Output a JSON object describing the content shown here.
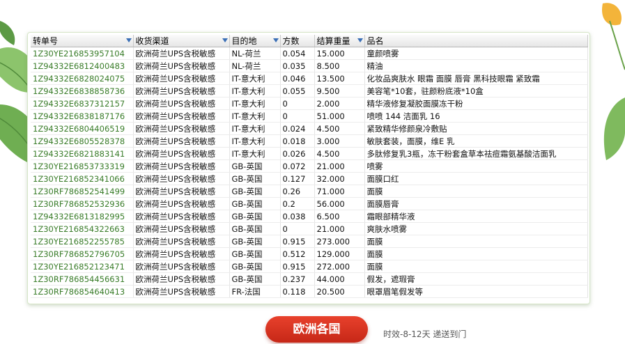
{
  "table": {
    "columns": [
      "转单号",
      "收货渠道",
      "目的地",
      "方数",
      "结算重量",
      "品名"
    ],
    "rows": [
      [
        "1Z30YE216853957104",
        "欧洲荷兰UPS含税敏感",
        "NL-荷兰",
        "0.054",
        "15.000",
        "童颜喷雾"
      ],
      [
        "1Z94332E6812400483",
        "欧洲荷兰UPS含税敏感",
        "NL-荷兰",
        "0.035",
        "8.500",
        "精油"
      ],
      [
        "1Z94332E6828024075",
        "欧洲荷兰UPS含税敏感",
        "IT-意大利",
        "0.046",
        "13.500",
        "化妆品爽肤水 眼霜 面膜 唇膏 黑科技眼霜 紧致霜"
      ],
      [
        "1Z94332E6838858736",
        "欧洲荷兰UPS含税敏感",
        "IT-意大利",
        "0.055",
        "9.500",
        "美容笔*10套，驻颜粉底液*10盒"
      ],
      [
        "1Z94332E6837312157",
        "欧洲荷兰UPS含税敏感",
        "IT-意大利",
        "0",
        "2.000",
        "精华液修复凝胶面膜冻干粉"
      ],
      [
        "1Z94332E6838187176",
        "欧洲荷兰UPS含税敏感",
        "IT-意大利",
        "0",
        "51.000",
        "喷喷 144 洁面乳 16"
      ],
      [
        "1Z94332E6804406519",
        "欧洲荷兰UPS含税敏感",
        "IT-意大利",
        "0.024",
        "4.500",
        "紧致精华修颜泉冷敷贴"
      ],
      [
        "1Z94332E6805528378",
        "欧洲荷兰UPS含税敏感",
        "IT-意大利",
        "0.018",
        "3.000",
        "敏肤套装，面膜，维E 乳"
      ],
      [
        "1Z94332E6821883141",
        "欧洲荷兰UPS含税敏感",
        "IT-意大利",
        "0.026",
        "4.500",
        "多肽修复乳3瓶，冻干粉套盒草本祛痘霜氨基酸洁面乳"
      ],
      [
        "1Z30YE216853733319",
        "欧洲荷兰UPS含税敏感",
        "GB-英国",
        "0.072",
        "21.000",
        "喷雾"
      ],
      [
        "1Z30YE216852341066",
        "欧洲荷兰UPS含税敏感",
        "GB-英国",
        "0.127",
        "32.000",
        "面膜口红"
      ],
      [
        "1Z30RF786852541499",
        "欧洲荷兰UPS含税敏感",
        "GB-英国",
        "0.26",
        "71.000",
        "面膜"
      ],
      [
        "1Z30RF786852532936",
        "欧洲荷兰UPS含税敏感",
        "GB-英国",
        "0.2",
        "56.000",
        "面膜唇膏"
      ],
      [
        "1Z94332E6813182995",
        "欧洲荷兰UPS含税敏感",
        "GB-英国",
        "0.038",
        "6.500",
        "霜眼部精华液"
      ],
      [
        "1Z30YE216854322663",
        "欧洲荷兰UPS含税敏感",
        "GB-英国",
        "0",
        "21.000",
        "爽肤水喷雾"
      ],
      [
        "1Z30YE216852255785",
        "欧洲荷兰UPS含税敏感",
        "GB-英国",
        "0.915",
        "273.000",
        "面膜"
      ],
      [
        "1Z30RF786852796705",
        "欧洲荷兰UPS含税敏感",
        "GB-英国",
        "0.512",
        "129.000",
        "面膜"
      ],
      [
        "1Z30YE216852123471",
        "欧洲荷兰UPS含税敏感",
        "GB-英国",
        "0.915",
        "272.000",
        "面膜"
      ],
      [
        "1Z30RF786854456631",
        "欧洲荷兰UPS含税敏感",
        "GB-英国",
        "0.237",
        "44.000",
        "假发，遮瑕膏"
      ],
      [
        "1Z30RF786854640413",
        "欧洲荷兰UPS含税敏感",
        "FR-法国",
        "0.118",
        "20.500",
        "眼罩眉笔假发等"
      ]
    ]
  },
  "footer": {
    "button_label": "欧洲各国",
    "note": "时效-8-12天 递送到门"
  },
  "colors": {
    "tracking_text": "#3a7d2a",
    "filter_arrow": "#3b6fb6",
    "button": "#d8321f"
  }
}
